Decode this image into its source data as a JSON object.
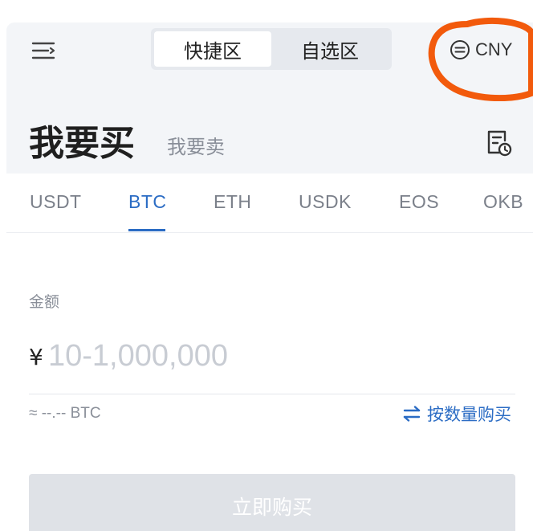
{
  "header": {
    "segments": [
      {
        "label": "快捷区",
        "active": true
      },
      {
        "label": "自选区",
        "active": false
      }
    ],
    "currency": "CNY",
    "icons": {
      "menu": "menu-icon",
      "currency": "exchange-circle-icon"
    }
  },
  "trade": {
    "buy_title": "我要买",
    "sell_title": "我要卖",
    "order_icon": "order-history-icon"
  },
  "tabs": [
    {
      "label": "USDT",
      "active": false
    },
    {
      "label": "BTC",
      "active": true
    },
    {
      "label": "ETH",
      "active": false
    },
    {
      "label": "USDK",
      "active": false
    },
    {
      "label": "EOS",
      "active": false
    },
    {
      "label": "OKB",
      "active": false
    }
  ],
  "form": {
    "amount_label": "金额",
    "currency_symbol": "¥",
    "amount_value": "",
    "amount_placeholder": "10-1,000,000",
    "approx_text": "≈ --.-- BTC",
    "switch_label": "按数量购买",
    "buy_button": "立即购买"
  },
  "colors": {
    "accent": "#2b6cc4",
    "header_bg": "#f3f5f8",
    "annotation": "#f25a0c",
    "disabled_button": "#dfe2e7"
  }
}
